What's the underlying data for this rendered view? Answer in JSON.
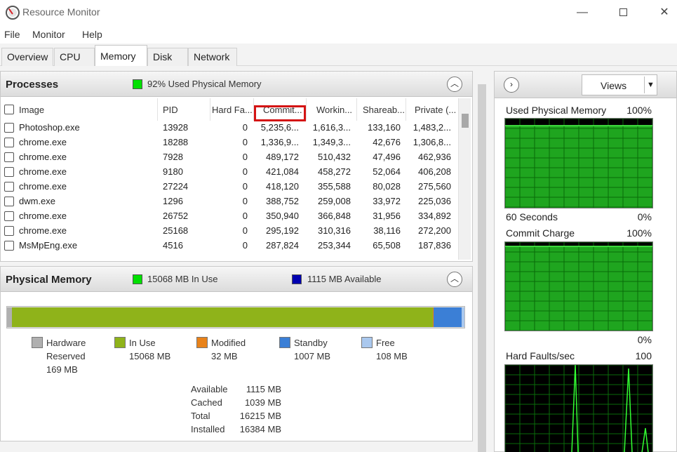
{
  "window": {
    "title": "Resource Monitor",
    "minimize": "—",
    "close": "✕"
  },
  "menu": [
    "File",
    "Monitor",
    "Help"
  ],
  "tabs": [
    "Overview",
    "CPU",
    "Memory",
    "Disk",
    "Network"
  ],
  "active_tab": "Memory",
  "processes": {
    "title": "Processes",
    "status": "92% Used Physical Memory",
    "status_color": "#00e000",
    "columns": [
      "Image",
      "PID",
      "Hard Fa...",
      "Commit...",
      "Workin...",
      "Shareab...",
      "Private (..."
    ],
    "rows": [
      {
        "image": "Photoshop.exe",
        "pid": "13928",
        "hard": "0",
        "commit": "5,235,6...",
        "working": "1,616,3...",
        "share": "133,160",
        "private": "1,483,2..."
      },
      {
        "image": "chrome.exe",
        "pid": "18288",
        "hard": "0",
        "commit": "1,336,9...",
        "working": "1,349,3...",
        "share": "42,676",
        "private": "1,306,8..."
      },
      {
        "image": "chrome.exe",
        "pid": "7928",
        "hard": "0",
        "commit": "489,172",
        "working": "510,432",
        "share": "47,496",
        "private": "462,936"
      },
      {
        "image": "chrome.exe",
        "pid": "9180",
        "hard": "0",
        "commit": "421,084",
        "working": "458,272",
        "share": "52,064",
        "private": "406,208"
      },
      {
        "image": "chrome.exe",
        "pid": "27224",
        "hard": "0",
        "commit": "418,120",
        "working": "355,588",
        "share": "80,028",
        "private": "275,560"
      },
      {
        "image": "dwm.exe",
        "pid": "1296",
        "hard": "0",
        "commit": "388,752",
        "working": "259,008",
        "share": "33,972",
        "private": "225,036"
      },
      {
        "image": "chrome.exe",
        "pid": "26752",
        "hard": "0",
        "commit": "350,940",
        "working": "366,848",
        "share": "31,956",
        "private": "334,892"
      },
      {
        "image": "chrome.exe",
        "pid": "25168",
        "hard": "0",
        "commit": "295,192",
        "working": "310,316",
        "share": "38,116",
        "private": "272,200"
      },
      {
        "image": "MsMpEng.exe",
        "pid": "4516",
        "hard": "0",
        "commit": "287,824",
        "working": "253,344",
        "share": "65,508",
        "private": "187,836"
      }
    ]
  },
  "physical_memory": {
    "title": "Physical Memory",
    "in_use_label": "15068 MB In Use",
    "available_label": "1115 MB Available",
    "in_use_color": "#00e000",
    "available_color": "#0000b0",
    "bar_fractions": {
      "hardware": 0.0103,
      "in_use": 0.9197,
      "modified": 0.002,
      "standby": 0.0615,
      "free": 0.0066
    },
    "legend": [
      {
        "name": "Hardware\nReserved",
        "value": "169 MB",
        "color": "#b0b0b0"
      },
      {
        "name": "In Use",
        "value": "15068 MB",
        "color": "#8fb31a"
      },
      {
        "name": "Modified",
        "value": "32 MB",
        "color": "#e8821a"
      },
      {
        "name": "Standby",
        "value": "1007 MB",
        "color": "#3b7fd6"
      },
      {
        "name": "Free",
        "value": "108 MB",
        "color": "#aac8ee"
      }
    ],
    "stats": [
      {
        "label": "Available",
        "value": "1115 MB"
      },
      {
        "label": "Cached",
        "value": "1039 MB"
      },
      {
        "label": "Total",
        "value": "16215 MB"
      },
      {
        "label": "Installed",
        "value": "16384 MB"
      }
    ]
  },
  "side_panel": {
    "views_label": "Views",
    "graphs": [
      {
        "title": "Used Physical Memory",
        "max": "100%",
        "footer_left": "60 Seconds",
        "footer_right": "0%",
        "level": 0.92
      },
      {
        "title": "Commit Charge",
        "max": "100%",
        "footer_left": "",
        "footer_right": "0%",
        "level": 0.95
      },
      {
        "title": "Hard Faults/sec",
        "max": "100",
        "footer_left": "",
        "footer_right": "",
        "level": 0.0
      }
    ]
  }
}
